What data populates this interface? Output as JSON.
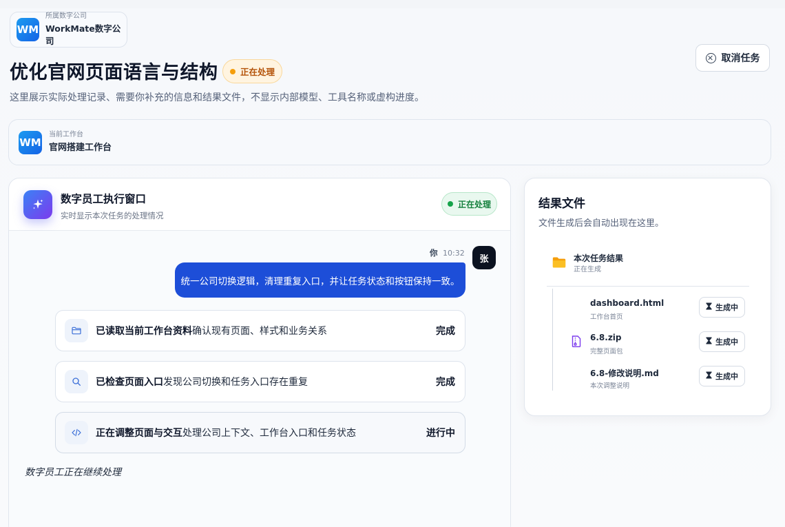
{
  "company": {
    "logo_text": "WM",
    "label": "所属数字公司",
    "name": "WorkMate数字公司"
  },
  "header": {
    "title": "优化官网页面语言与结构",
    "status_badge": "正在处理",
    "subtitle": "这里展示实际处理记录、需要你补充的信息和结果文件，不显示内部模型、工具名称或虚构进度。",
    "cancel_label": "取消任务"
  },
  "workspace": {
    "logo_text": "WM",
    "label": "当前工作台",
    "name": "官网搭建工作台"
  },
  "exec_window": {
    "title": "数字员工执行窗口",
    "subtitle": "实时显示本次任务的处理情况",
    "status_badge": "正在处理",
    "message": {
      "sender": "你",
      "time": "10:32",
      "avatar": "张",
      "text": "统一公司切换逻辑，清理重复入口，并让任务状态和按钮保持一致。"
    },
    "steps": [
      {
        "title": "已读取当前工作台资料",
        "detail": "确认现有页面、样式和业务关系",
        "status": "完成",
        "icon": "folder-icon"
      },
      {
        "title": "已检查页面入口",
        "detail": "发现公司切换和任务入口存在重复",
        "status": "完成",
        "icon": "search-icon"
      },
      {
        "title": "正在调整页面与交互",
        "detail": "处理公司上下文、工作台入口和任务状态",
        "status": "进行中",
        "icon": "code-icon"
      }
    ],
    "continuing": "数字员工正在继续处理"
  },
  "results": {
    "title": "结果文件",
    "subtitle": "文件生成后会自动出现在这里。",
    "folder": {
      "name": "本次任务结果",
      "status": "正在生成"
    },
    "files": [
      {
        "name": "dashboard.html",
        "desc": "工作台首页",
        "action": "生成中"
      },
      {
        "name": "6.8.zip",
        "desc": "完整页面包",
        "action": "生成中"
      },
      {
        "name": "6.8-修改说明.md",
        "desc": "本次调整说明",
        "action": "生成中"
      }
    ]
  },
  "colors": {
    "accent_blue": "#1d4ed8",
    "processing_orange": "#f59e0b",
    "processing_green": "#16a34a"
  }
}
